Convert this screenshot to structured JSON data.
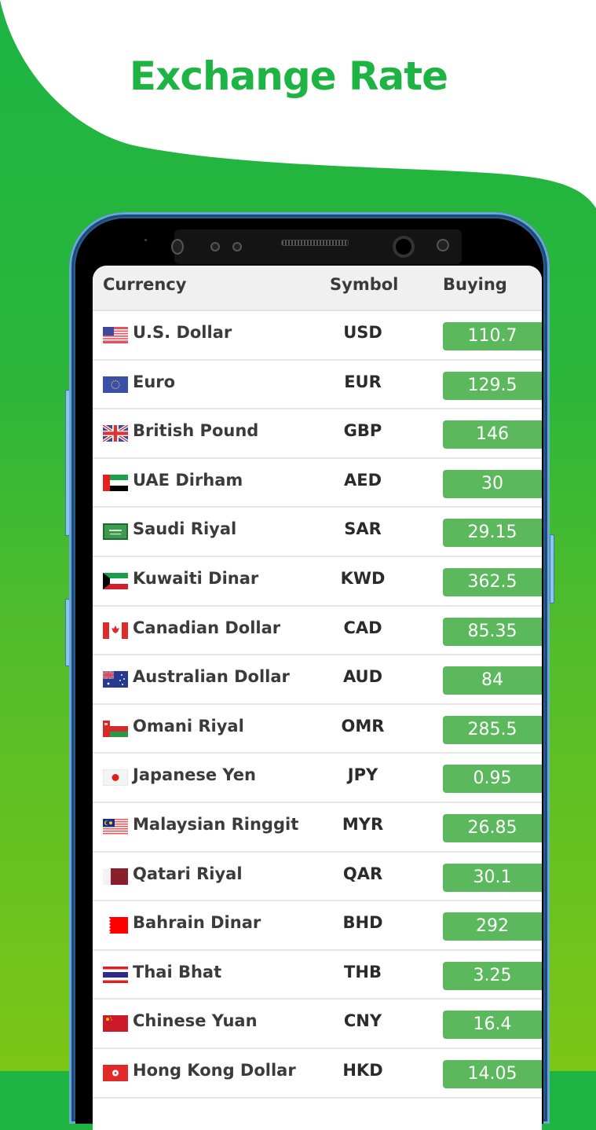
{
  "header": {
    "title": "Exchange Rate"
  },
  "colors": {
    "brand_green": "#1db443",
    "rate_badge": "#5cb85c",
    "gradient_bottom": "#7cc616"
  },
  "table": {
    "columns": [
      "Currency",
      "Symbol",
      "Buying"
    ],
    "rows": [
      {
        "flag": "us-flag-icon",
        "currency": "U.S. Dollar",
        "symbol": "USD",
        "buying": "110.7"
      },
      {
        "flag": "eu-flag-icon",
        "currency": "Euro",
        "symbol": "EUR",
        "buying": "129.5"
      },
      {
        "flag": "uk-flag-icon",
        "currency": "British Pound",
        "symbol": "GBP",
        "buying": "146"
      },
      {
        "flag": "uae-flag-icon",
        "currency": "UAE Dirham",
        "symbol": "AED",
        "buying": "30"
      },
      {
        "flag": "saudi-flag-icon",
        "currency": "Saudi Riyal",
        "symbol": "SAR",
        "buying": "29.15"
      },
      {
        "flag": "kuwait-flag-icon",
        "currency": "Kuwaiti Dinar",
        "symbol": "KWD",
        "buying": "362.5"
      },
      {
        "flag": "canada-flag-icon",
        "currency": "Canadian Dollar",
        "symbol": "CAD",
        "buying": "85.35"
      },
      {
        "flag": "australia-flag-icon",
        "currency": "Australian Dollar",
        "symbol": "AUD",
        "buying": "84"
      },
      {
        "flag": "oman-flag-icon",
        "currency": "Omani Riyal",
        "symbol": "OMR",
        "buying": "285.5"
      },
      {
        "flag": "japan-flag-icon",
        "currency": "Japanese Yen",
        "symbol": "JPY",
        "buying": "0.95"
      },
      {
        "flag": "malaysia-flag-icon",
        "currency": "Malaysian Ringgit",
        "symbol": "MYR",
        "buying": "26.85"
      },
      {
        "flag": "qatar-flag-icon",
        "currency": "Qatari Riyal",
        "symbol": "QAR",
        "buying": "30.1"
      },
      {
        "flag": "bahrain-flag-icon",
        "currency": "Bahrain Dinar",
        "symbol": "BHD",
        "buying": "292"
      },
      {
        "flag": "thailand-flag-icon",
        "currency": "Thai Bhat",
        "symbol": "THB",
        "buying": "3.25"
      },
      {
        "flag": "china-flag-icon",
        "currency": "Chinese Yuan",
        "symbol": "CNY",
        "buying": "16.4"
      },
      {
        "flag": "hongkong-flag-icon",
        "currency": "Hong Kong Dollar",
        "symbol": "HKD",
        "buying": "14.05"
      }
    ]
  }
}
